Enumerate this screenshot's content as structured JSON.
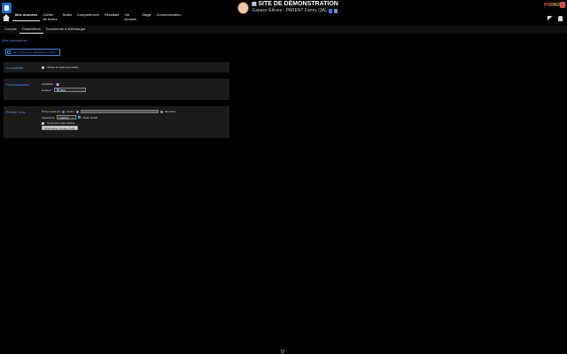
{
  "header": {
    "site_title": "SITE DE DÉMONSTRATION",
    "site_subtitle": "Espace Élèves - PARENT Fanny (3A)",
    "brand": [
      "PR",
      "ON",
      "O",
      "TE"
    ],
    "nav": [
      {
        "label": "Mes données",
        "active": true
      },
      {
        "label": "Cahier\nde textes",
        "active": false
      },
      {
        "label": "Notes",
        "active": false
      },
      {
        "label": "Compétences",
        "active": false
      },
      {
        "label": "Résultats",
        "active": false
      },
      {
        "label": "Vie\nscolaire",
        "active": false
      },
      {
        "label": "Stage",
        "active": false
      },
      {
        "label": "Communication",
        "active": false
      }
    ]
  },
  "subnav": {
    "items": [
      {
        "label": "Compte",
        "active": false
      },
      {
        "label": "Paramètres",
        "active": true
      },
      {
        "label": "Documents à télécharger",
        "active": false
      }
    ]
  },
  "main": {
    "page_title": "Mes paramètres",
    "notice_button": "Voir l'Accès pour l'application mobile",
    "accessibility": {
      "section_label": "Accessibilité",
      "checkbox_label": "Activer le mode accessible",
      "checked": false
    },
    "personalisation": {
      "section_label": "Personnalisation",
      "language_label": "LANGUE :",
      "color_label": "Couleur :",
      "color_value": "Bleu"
    },
    "pronote_tools": {
      "section_label": "Pronote Tools",
      "proxy_label": "Proxy requis (1)",
      "proxy_option_none": "Aucun",
      "proxy_placeholder": "",
      "proxy_option_direct": "Direct/ed",
      "appearance_label": "Apparence",
      "appearance_value": "Gradient",
      "oled_label": "Mode OLED",
      "oled_checked": true,
      "auto_connect_label": "Connexion automatique",
      "auto_connect_checked": false,
      "reset_button": "Réinitialiser Pronote Tools"
    }
  }
}
